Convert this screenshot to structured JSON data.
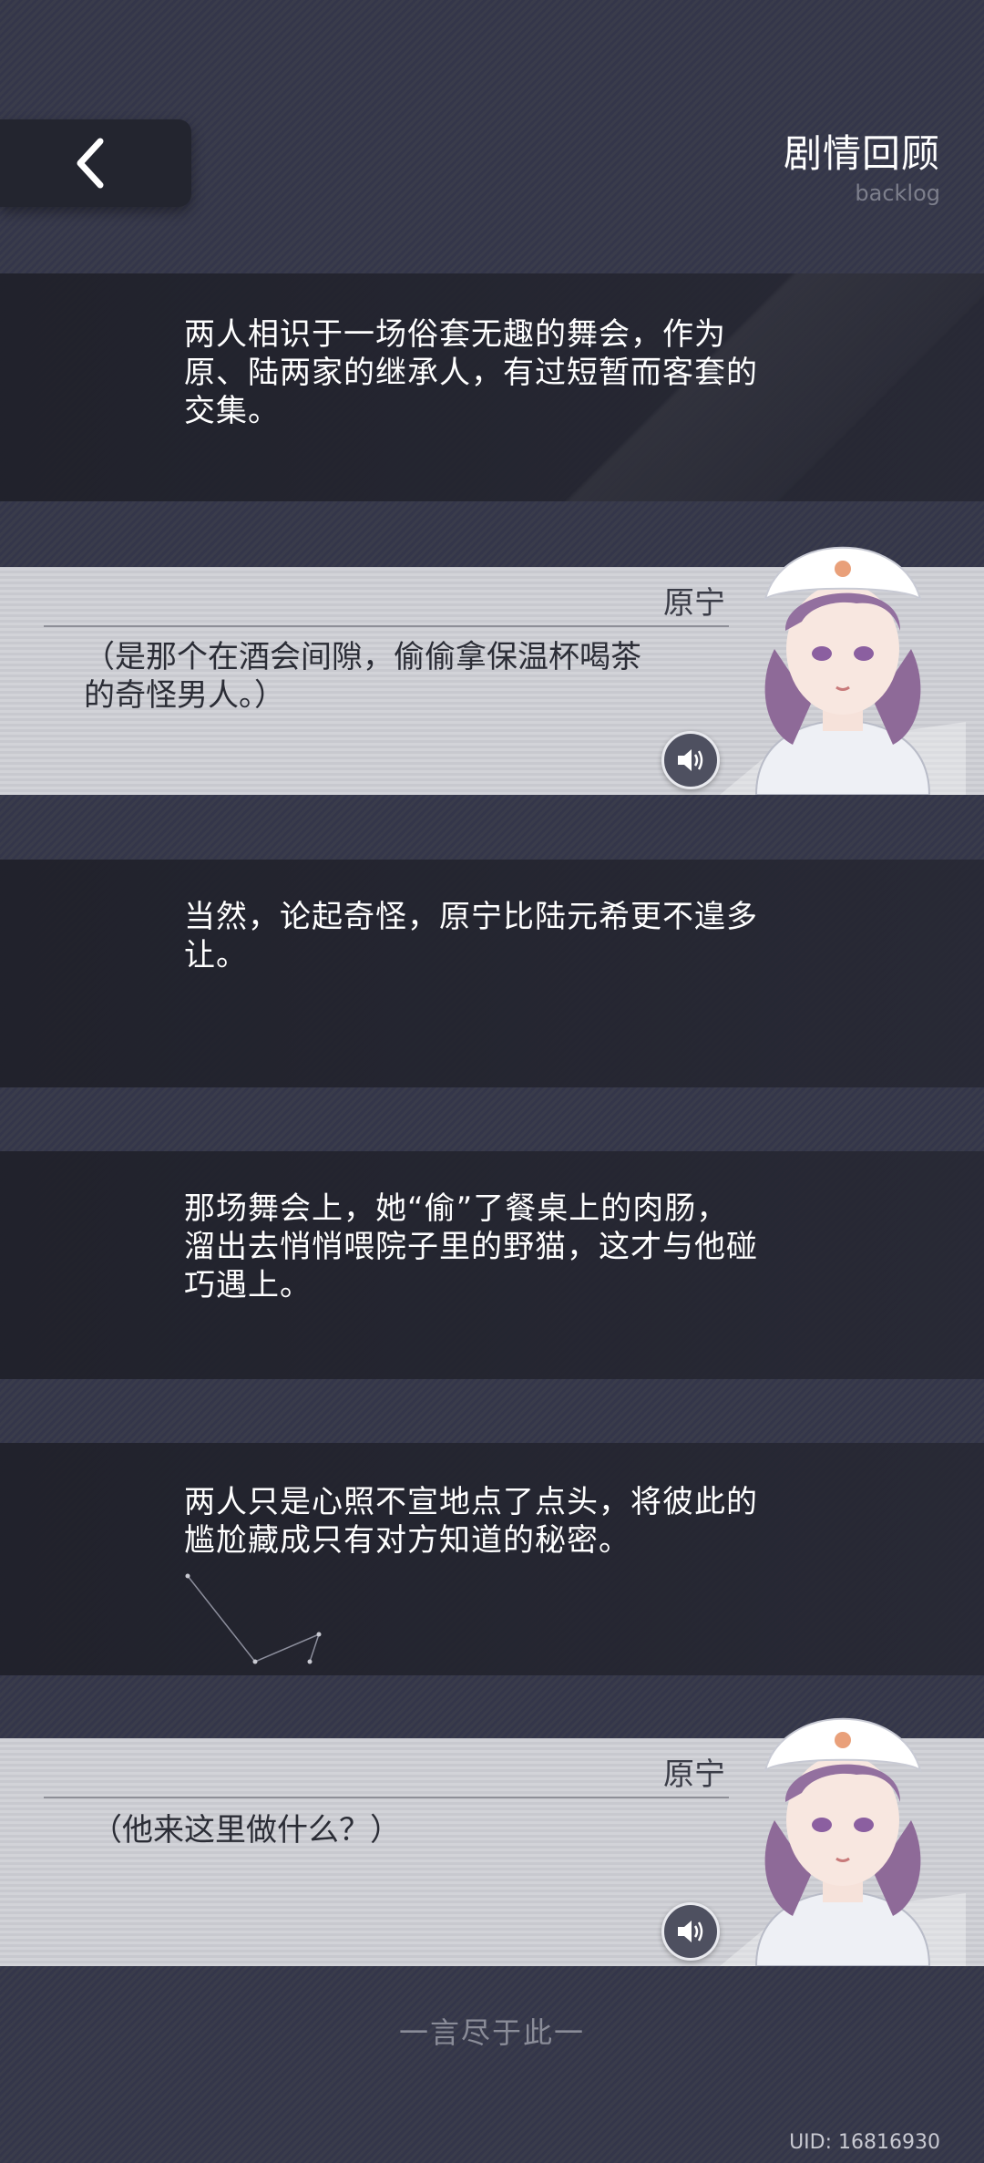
{
  "header": {
    "title": "剧情回顾",
    "subtitle": "backlog",
    "back_icon": "chevron-left-icon"
  },
  "entries": [
    {
      "type": "narration",
      "text_lines": [
        "两人相识于一场俗套无趣的舞会，作为",
        "原、陆两家的继承人，有过短暂而客套的",
        "交集。"
      ]
    },
    {
      "type": "dialog",
      "speaker": "原宁",
      "text_lines": [
        "（是那个在酒会间隙，偷偷拿保温杯喝茶",
        "的奇怪男人。）"
      ],
      "voice_icon": "speaker-icon"
    },
    {
      "type": "narration",
      "text_lines": [
        "当然，论起奇怪，原宁比陆元希更不遑多",
        "让。"
      ]
    },
    {
      "type": "narration",
      "text_lines": [
        "那场舞会上，她“偷”了餐桌上的肉肠，",
        "溜出去悄悄喂院子里的野猫，这才与他碰",
        "巧遇上。"
      ]
    },
    {
      "type": "narration",
      "text_lines": [
        "两人只是心照不宣地点了点头，将彼此的",
        "尴尬藏成只有对方知道的秘密。"
      ]
    },
    {
      "type": "dialog",
      "speaker": "原宁",
      "text_lines": [
        "（他来这里做什么？）"
      ],
      "voice_icon": "speaker-icon"
    }
  ],
  "footer": {
    "end_text": "一言尽于此一",
    "uid": "UID: 16816930"
  },
  "colors": {
    "background": "#3a3c4b",
    "narration_panel": "#22232d",
    "dialog_panel": "#d0d1d6",
    "dialog_text": "#2b2d36",
    "voice_button": "#4e5060"
  }
}
